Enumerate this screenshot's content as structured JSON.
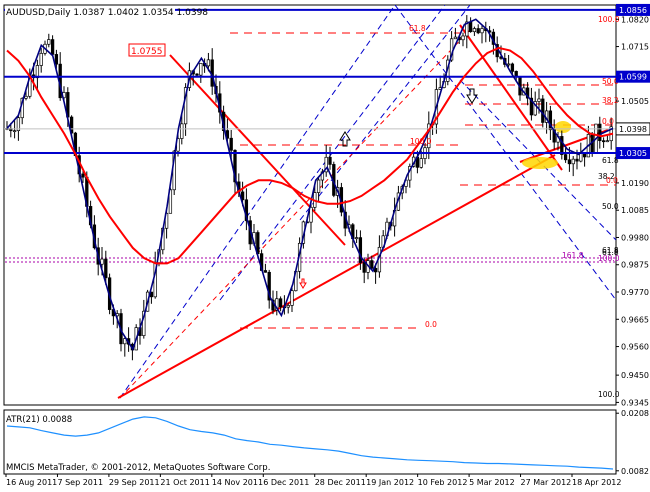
{
  "chart_data": [
    {
      "type": "line",
      "title": "AUDUSD,Daily",
      "ohlc": {
        "open": "1.0387",
        "high": "1.0402",
        "low": "1.0354",
        "close": "1.0398"
      },
      "ylim": [
        0.9335,
        1.0875
      ],
      "y_ticks": [
        "1.0820",
        "1.0715",
        "1.0610",
        "1.0505",
        "1.0295",
        "1.0190",
        "1.0085",
        "0.9980",
        "0.9875",
        "0.9770",
        "0.9665",
        "0.9560",
        "0.9450",
        "0.9345"
      ],
      "x_ticks": [
        "16 Aug 2011",
        "7 Sep 2011",
        "29 Sep 2011",
        "21 Oct 2011",
        "14 Nov 2011",
        "6 Dec 2011",
        "28 Dec 2011",
        "19 Jan 2012",
        "10 Feb 2012",
        "5 Mar 2012",
        "27 Mar 2012",
        "18 Apr 2012"
      ],
      "horizontal_levels": [
        {
          "value": 1.0856,
          "label": "1.0856",
          "color": "#0000cc"
        },
        {
          "value": 1.0599,
          "label": "1.0599",
          "color": "#0000cc"
        },
        {
          "value": 1.0305,
          "label": "1.0305",
          "color": "#0000cc"
        }
      ],
      "current_price": {
        "value": 1.0398,
        "label": "1.0398"
      },
      "price_marker": {
        "value": 1.0755,
        "label": "1.0755"
      },
      "fibonacci_labels": [
        "100.0",
        "61.8",
        "50.0",
        "38.2",
        "0.0",
        "61.8",
        "100.0",
        "0.0",
        "100.0",
        "61.8",
        "38.2",
        "0.0",
        "50.0",
        "61.8",
        "161.8",
        "100.0"
      ],
      "series": [
        {
          "name": "",
          "color": "#000080",
          "values": [
            1.04,
            1.045,
            1.06,
            1.072,
            1.068,
            1.05,
            1.03,
            1.01,
            0.99,
            0.975,
            0.962,
            0.955,
            0.968,
            0.985,
            1.01,
            1.04,
            1.06,
            1.067,
            1.06,
            1.04,
            1.02,
            1.005,
            0.99,
            0.975,
            0.968,
            0.98,
            1.0,
            1.02,
            1.025,
            1.015,
            1.0,
            0.99,
            0.985,
            0.995,
            1.01,
            1.022,
            1.03,
            1.04,
            1.055,
            1.07,
            1.08,
            1.082,
            1.078,
            1.07,
            1.062,
            1.055,
            1.05,
            1.045,
            1.038,
            1.032,
            1.03,
            1.034,
            1.038,
            1.04
          ]
        },
        {
          "name": "",
          "color": "#ff0000",
          "values": [
            1.07,
            1.066,
            1.06,
            1.052,
            1.045,
            1.038,
            1.03,
            1.021,
            1.013,
            1.006,
            1.0,
            0.994,
            0.99,
            0.988,
            0.988,
            0.99,
            0.995,
            1.0,
            1.005,
            1.01,
            1.015,
            1.018,
            1.02,
            1.02,
            1.019,
            1.017,
            1.014,
            1.012,
            1.011,
            1.011,
            1.012,
            1.014,
            1.017,
            1.02,
            1.024,
            1.028,
            1.034,
            1.04,
            1.047,
            1.054,
            1.06,
            1.065,
            1.069,
            1.071,
            1.07,
            1.067,
            1.062,
            1.056,
            1.05,
            1.045,
            1.041,
            1.038,
            1.037,
            1.038
          ]
        }
      ]
    },
    {
      "type": "area",
      "title": "ATR(21) 0.0088",
      "ylim": [
        0.0075,
        0.0215
      ],
      "y_ticks": [
        "0.0208",
        "0.0082"
      ],
      "values": [
        0.018,
        0.0178,
        0.0176,
        0.017,
        0.0165,
        0.016,
        0.0158,
        0.016,
        0.0165,
        0.0175,
        0.0185,
        0.0195,
        0.02,
        0.0198,
        0.019,
        0.018,
        0.0172,
        0.0168,
        0.0165,
        0.016,
        0.0152,
        0.0148,
        0.0145,
        0.014,
        0.0138,
        0.0135,
        0.0132,
        0.013,
        0.0128,
        0.0125,
        0.012,
        0.0115,
        0.0112,
        0.011,
        0.0108,
        0.0106,
        0.0105,
        0.0104,
        0.0103,
        0.0102,
        0.01,
        0.0099,
        0.0098,
        0.0098,
        0.0097,
        0.0096,
        0.0095,
        0.0094,
        0.0093,
        0.0092,
        0.009,
        0.0089,
        0.0088,
        0.0086
      ]
    }
  ],
  "footer": {
    "copyright": "MMCIS MetaTrader, © 2001-2012, MetaQuotes Software Corp."
  }
}
